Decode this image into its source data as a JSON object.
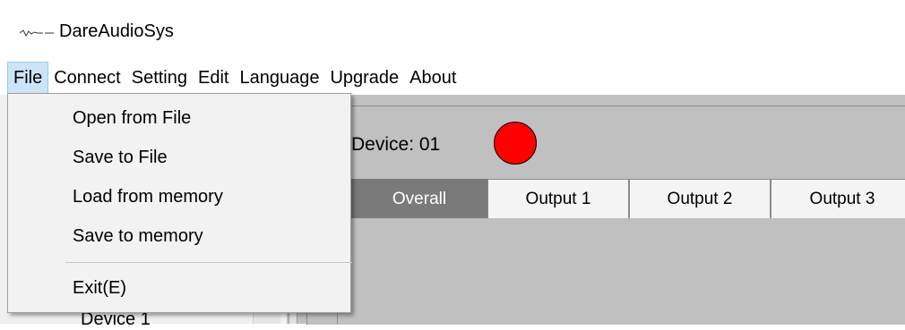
{
  "window": {
    "title": "DareAudioSys",
    "icon": "app-waveform-icon"
  },
  "menubar": {
    "items": [
      {
        "label": "File",
        "active": true
      },
      {
        "label": "Connect"
      },
      {
        "label": "Setting"
      },
      {
        "label": "Edit"
      },
      {
        "label": "Language"
      },
      {
        "label": "Upgrade"
      },
      {
        "label": "About"
      }
    ]
  },
  "file_menu": {
    "items": [
      {
        "label": "Open from File"
      },
      {
        "label": "Save to File"
      },
      {
        "label": "Load from memory"
      },
      {
        "label": "Save to memory"
      },
      {
        "label": "Exit(E)"
      }
    ]
  },
  "device": {
    "label": "Device: 01",
    "status_color": "#ff0000"
  },
  "tabs": [
    {
      "label": "Overall",
      "active": true
    },
    {
      "label": "Output 1"
    },
    {
      "label": "Output 2"
    },
    {
      "label": "Output 3"
    }
  ],
  "left_panel": {
    "partial_item": "Device 1"
  },
  "colors": {
    "menu_active_bg": "#cce4f7",
    "tab_active_bg": "#7a7a7a",
    "workspace_bg": "#c0c0c0"
  }
}
